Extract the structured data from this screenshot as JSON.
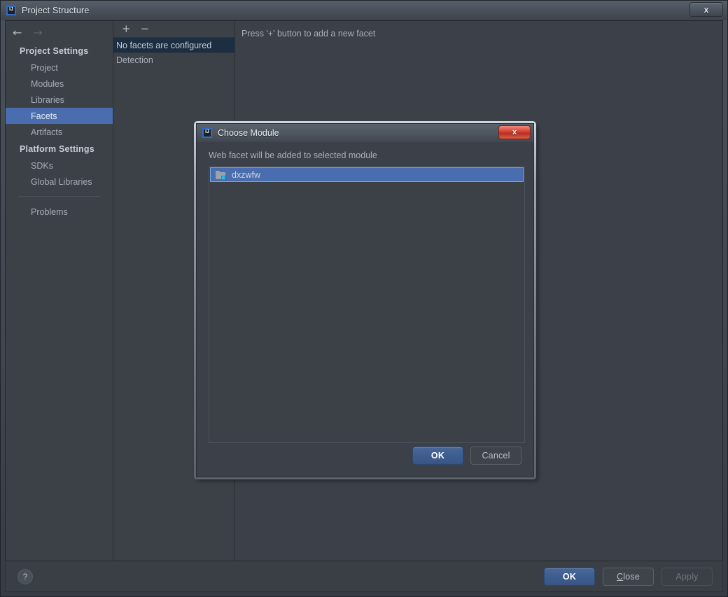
{
  "window": {
    "title": "Project Structure",
    "app_icon": "intellij-idea-icon",
    "close_label": "x"
  },
  "nav": {
    "back_icon": "arrow-left-icon",
    "forward_icon": "arrow-right-icon",
    "back_enabled": true,
    "forward_enabled": false
  },
  "sidebar": {
    "groups": [
      {
        "heading": "Project Settings",
        "items": [
          {
            "label": "Project",
            "selected": false
          },
          {
            "label": "Modules",
            "selected": false
          },
          {
            "label": "Libraries",
            "selected": false
          },
          {
            "label": "Facets",
            "selected": true
          },
          {
            "label": "Artifacts",
            "selected": false
          }
        ]
      },
      {
        "heading": "Platform Settings",
        "items": [
          {
            "label": "SDKs",
            "selected": false
          },
          {
            "label": "Global Libraries",
            "selected": false
          }
        ]
      }
    ],
    "extra_items": [
      {
        "label": "Problems",
        "selected": false
      }
    ]
  },
  "facets": {
    "toolbar": {
      "add_label": "+",
      "add_icon": "plus-icon",
      "remove_label": "−",
      "remove_icon": "minus-icon"
    },
    "rows": [
      {
        "label": "No facets are configured",
        "selected": true
      },
      {
        "label": "Detection",
        "selected": false
      }
    ]
  },
  "detail": {
    "hint": "Press '+' button to add a new facet"
  },
  "bottom_bar": {
    "help_label": "?",
    "help_icon": "question-mark-icon",
    "buttons": [
      {
        "label": "OK",
        "style": "default",
        "mnemonic": ""
      },
      {
        "label": "Close",
        "style": "normal",
        "mnemonic": "C"
      },
      {
        "label": "Apply",
        "style": "disabled",
        "mnemonic": ""
      }
    ]
  },
  "dialog": {
    "title": "Choose Module",
    "app_icon": "intellij-idea-icon",
    "close_label": "x",
    "prompt": "Web facet will be added to selected module",
    "modules": [
      {
        "label": "dxzwfw",
        "icon": "module-folder-icon",
        "selected": true
      }
    ],
    "buttons": [
      {
        "label": "OK",
        "style": "default"
      },
      {
        "label": "Cancel",
        "style": "normal"
      }
    ]
  },
  "colors": {
    "accent_selection": "#4a6daf",
    "inactive_selection": "#1c2f42",
    "panel_bg": "#3c4048",
    "close_red": "#d94b3c",
    "module_badge": "#2fc0e8"
  }
}
